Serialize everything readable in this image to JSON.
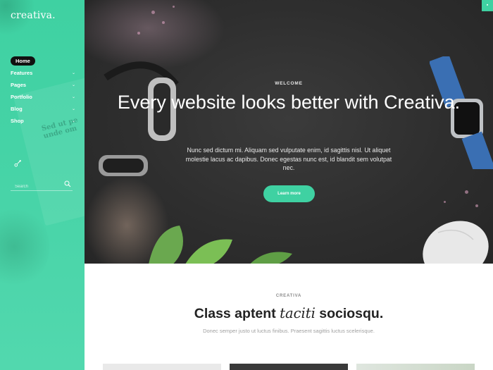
{
  "sidebar": {
    "logo": "creativa.",
    "nav": [
      {
        "label": "Home",
        "active": true,
        "has_submenu": false
      },
      {
        "label": "Features",
        "active": false,
        "has_submenu": true
      },
      {
        "label": "Pages",
        "active": false,
        "has_submenu": true
      },
      {
        "label": "Portfolio",
        "active": false,
        "has_submenu": true
      },
      {
        "label": "Blog",
        "active": false,
        "has_submenu": true
      },
      {
        "label": "Shop",
        "active": false,
        "has_submenu": true
      }
    ],
    "submenu_chevron": "⌄",
    "social_icon": "social-icon",
    "search": {
      "placeholder": "Search",
      "value": ""
    },
    "decor_text": "Sed ut pe\nunde om"
  },
  "hero": {
    "eyebrow": "WELCOME",
    "title": "Every website looks better with Creativa.",
    "text": "Nunc sed dictum mi. Aliquam sed vulputate enim, id sagittis nisl. Ut aliquet molestie lacus ac dapibus. Donec egestas nunc est, id blandit sem volutpat nec.",
    "button": "Learn more"
  },
  "section": {
    "eyebrow": "CREATIVA",
    "title_before": "Class aptent ",
    "title_italic": "taciti",
    "title_after": " sociosqu.",
    "subtitle": "Donec semper justo ut luctus finibus. Praesent sagittis luctus scelerisque."
  },
  "colors": {
    "accent": "#3fd1a2",
    "hero_bg": "#2e2e2e",
    "active_pill": "#111111"
  }
}
